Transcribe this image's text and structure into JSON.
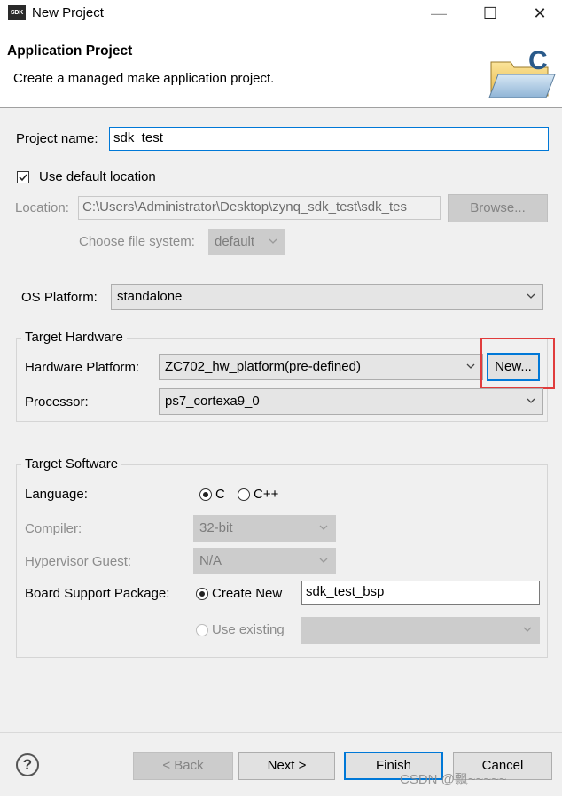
{
  "window": {
    "icon_text": "SDK",
    "title": "New Project",
    "minimize_glyph": "—",
    "maximize_glyph": "☐",
    "close_glyph": "✕"
  },
  "header": {
    "title": "Application Project",
    "description": "Create a managed make application project.",
    "icon_letter": "C"
  },
  "project": {
    "name_label": "Project name:",
    "name_value": "sdk_test",
    "use_default_label": "Use default location",
    "use_default_checked": true,
    "location_label": "Location:",
    "location_value": "C:\\Users\\Administrator\\Desktop\\zynq_sdk_test\\sdk_tes",
    "browse_label": "Browse...",
    "file_system_label": "Choose file system:",
    "file_system_value": "default"
  },
  "os": {
    "label": "OS Platform:",
    "value": "standalone"
  },
  "target_hardware": {
    "title": "Target Hardware",
    "platform_label": "Hardware Platform:",
    "platform_value": "ZC702_hw_platform(pre-defined)",
    "new_button": "New...",
    "processor_label": "Processor:",
    "processor_value": "ps7_cortexa9_0"
  },
  "target_software": {
    "title": "Target Software",
    "language_label": "Language:",
    "language_c": "C",
    "language_cpp": "C++",
    "language_selected": "C",
    "compiler_label": "Compiler:",
    "compiler_value": "32-bit",
    "hypervisor_label": "Hypervisor Guest:",
    "hypervisor_value": "N/A",
    "bsp_label": "Board Support Package:",
    "bsp_create_label": "Create New",
    "bsp_name": "sdk_test_bsp",
    "bsp_existing_label": "Use existing",
    "bsp_existing_value": ""
  },
  "footer": {
    "help_glyph": "?",
    "back_label": "< Back",
    "next_label": "Next >",
    "finish_label": "Finish",
    "cancel_label": "Cancel"
  },
  "watermark": "CSDN @飘~~~~~",
  "colors": {
    "accent": "#0078d7",
    "highlight": "#e03c3c",
    "background": "#f0f0f0"
  }
}
